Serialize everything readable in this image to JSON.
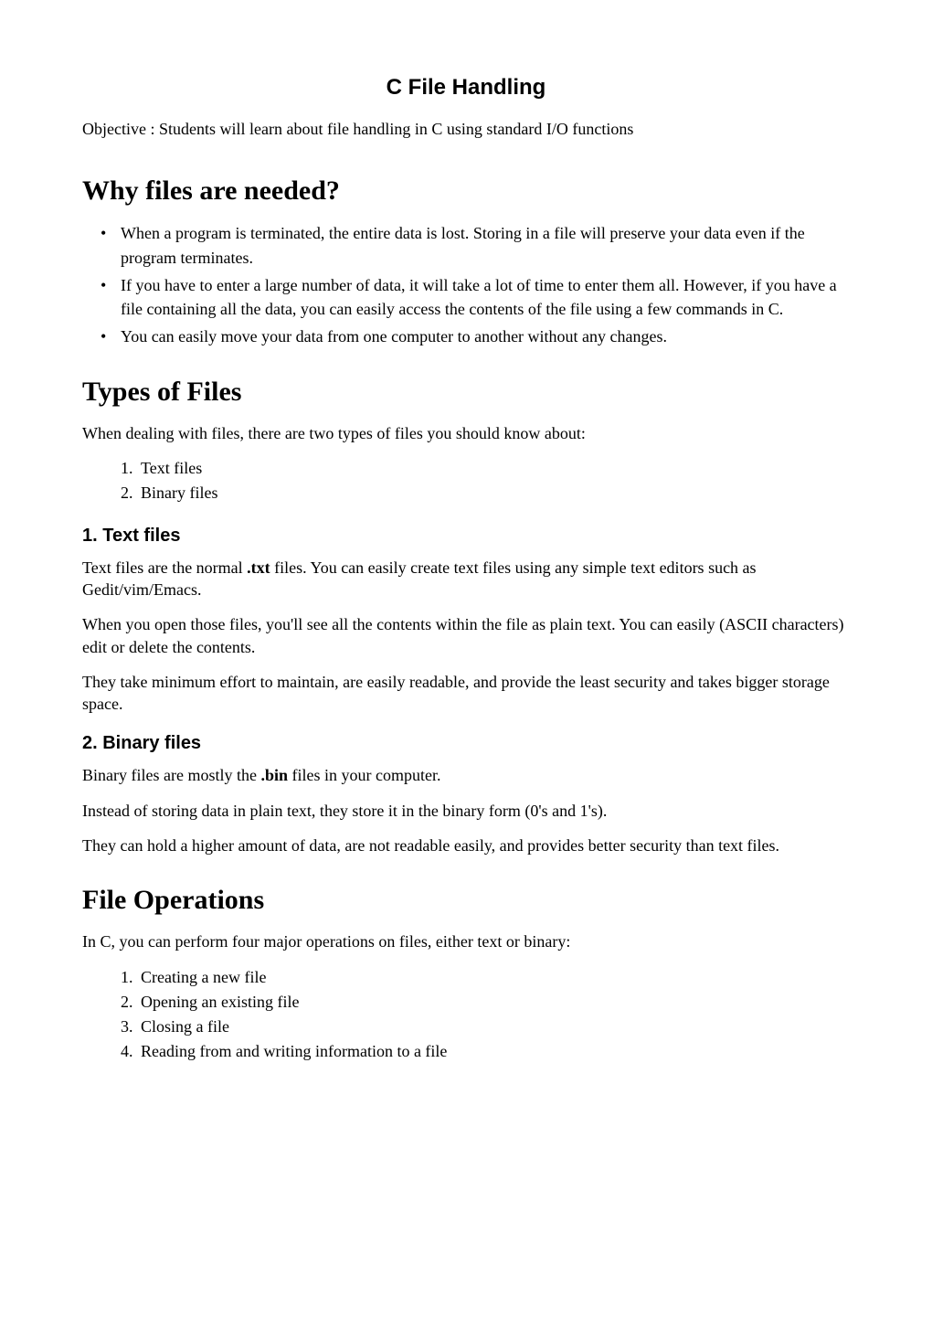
{
  "title": "C File Handling",
  "objective": "Objective : Students  will learn about file handling in C using standard I/O functions",
  "why": {
    "heading": "Why files are needed?",
    "items": [
      "When a program is terminated, the entire data is lost. Storing in a file will preserve your data even if the program terminates.",
      "If you have to enter a large number of data, it will take a lot of time to enter them all. However, if you have a file containing all the data, you can easily access the contents of the file using a few commands in C.",
      "You can easily move your data from one computer to another without any changes."
    ]
  },
  "types": {
    "heading": "Types of Files",
    "intro": "When dealing with files, there are two types of files you should know about:",
    "list": [
      "Text files",
      "Binary files"
    ],
    "text": {
      "heading": "1. Text files",
      "p1a": "Text files are the normal ",
      "p1b": ".txt",
      "p1c": " files. You can easily create text files using any simple text editors such as Gedit/vim/Emacs.",
      "p2": "When you open those files, you'll see all the contents within the file as plain text. You can easily (ASCII characters) edit or delete the contents.",
      "p3": "They take minimum effort to maintain, are easily readable, and provide the least security and takes bigger storage space."
    },
    "binary": {
      "heading": "2. Binary files",
      "p1a": "Binary files are mostly the ",
      "p1b": ".bin",
      "p1c": " files in your computer.",
      "p2": "Instead of storing data in plain text, they store it in the binary form (0's and 1's).",
      "p3": "They can hold a higher amount of data, are not readable easily, and provides better security than text files."
    }
  },
  "ops": {
    "heading": "File Operations",
    "intro": "In C, you can perform four major operations on files, either text or binary:",
    "list": [
      "Creating a new file",
      "Opening an existing file",
      "Closing a file",
      "Reading from and writing information to a file"
    ]
  }
}
